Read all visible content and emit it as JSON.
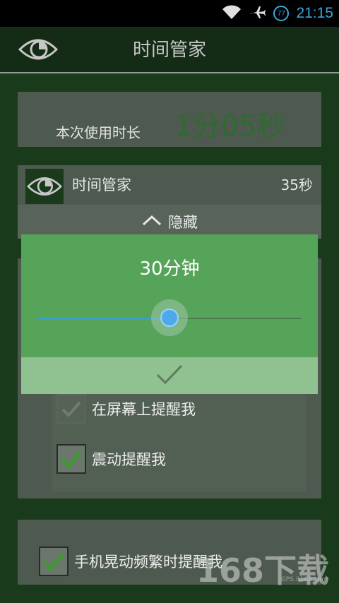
{
  "status": {
    "time": "21:15",
    "badge": "77"
  },
  "appbar": {
    "title": "时间管家"
  },
  "usage": {
    "label": "本次使用时长",
    "value": "1分05秒"
  },
  "app_row": {
    "name": "时间管家",
    "time": "35秒",
    "hide_label": "隐藏"
  },
  "options": [
    {
      "label": "在屏幕上提醒我",
      "checked": false
    },
    {
      "label": "震动提醒我",
      "checked": true
    }
  ],
  "shake_option": {
    "label": "手机晃动频繁时提醒我",
    "checked": true
  },
  "dialog": {
    "title": "30分钟",
    "slider_fraction": 0.5
  },
  "watermark": {
    "main": "168下载",
    "sub": "GPS.it168.com"
  }
}
